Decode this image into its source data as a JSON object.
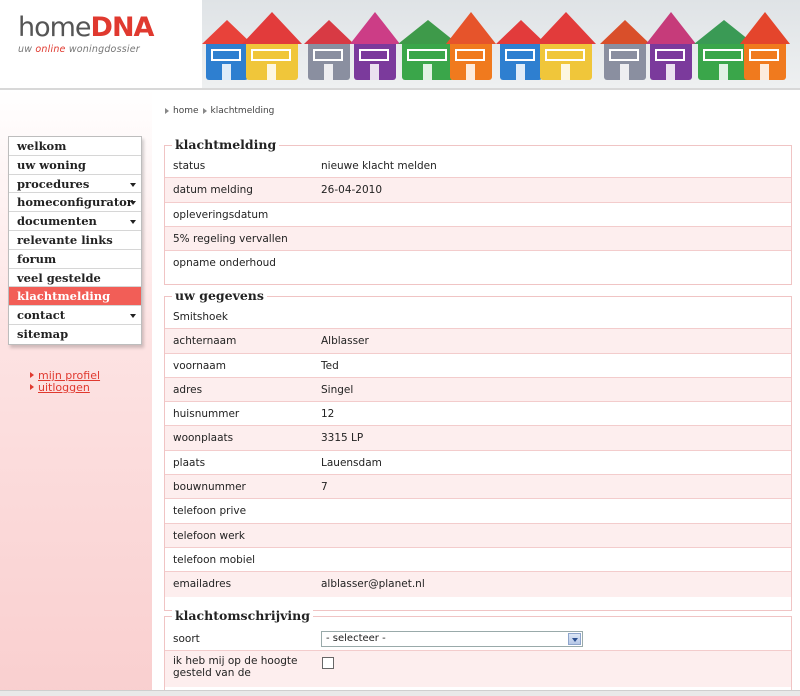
{
  "logo": {
    "brand_home": "home",
    "brand_dna": "DNA",
    "tag_pre": "uw ",
    "tag_online": "online",
    "tag_post": " woningdossier"
  },
  "colors": {
    "accent": "#e0392f",
    "active_menu": "#f25e57",
    "row_pink": "#fdeeee",
    "border_pink": "#f0c4c4"
  },
  "breadcrumb": {
    "items": [
      "home",
      "klachtmelding"
    ]
  },
  "menu": {
    "items": [
      {
        "label": "welkom",
        "has_dropdown": false,
        "active": false
      },
      {
        "label": "uw woning",
        "has_dropdown": false,
        "active": false
      },
      {
        "label": "procedures",
        "has_dropdown": true,
        "active": false
      },
      {
        "label": "homeconfigurator",
        "has_dropdown": true,
        "active": false
      },
      {
        "label": "documenten",
        "has_dropdown": true,
        "active": false
      },
      {
        "label": "relevante links",
        "has_dropdown": false,
        "active": false
      },
      {
        "label": "forum",
        "has_dropdown": false,
        "active": false
      },
      {
        "label": "veel gestelde vragen",
        "has_dropdown": false,
        "active": false
      },
      {
        "label": "klachtmelding",
        "has_dropdown": false,
        "active": true
      },
      {
        "label": "contact",
        "has_dropdown": true,
        "active": false
      },
      {
        "label": "sitemap",
        "has_dropdown": false,
        "active": false
      }
    ]
  },
  "profile_links": {
    "profile": "mijn profiel",
    "logout": "uitloggen"
  },
  "klachtmelding": {
    "title": "klachtmelding",
    "rows": [
      {
        "label": "status",
        "value": "nieuwe klacht melden"
      },
      {
        "label": "datum melding",
        "value": "26-04-2010"
      },
      {
        "label": "opleveringsdatum",
        "value": ""
      },
      {
        "label": "5% regeling vervallen",
        "value": ""
      },
      {
        "label": "opname onderhoud",
        "value": ""
      }
    ]
  },
  "gegevens": {
    "title": "uw gegevens",
    "rows": [
      {
        "label": "Smitshoek",
        "value": ""
      },
      {
        "label": "achternaam",
        "value": "Alblasser"
      },
      {
        "label": "voornaam",
        "value": "Ted"
      },
      {
        "label": "adres",
        "value": "Singel"
      },
      {
        "label": "huisnummer",
        "value": "12"
      },
      {
        "label": "woonplaats",
        "value": "3315 LP"
      },
      {
        "label": "plaats",
        "value": "Lauensdam"
      },
      {
        "label": "bouwnummer",
        "value": "7"
      },
      {
        "label": "telefoon prive",
        "value": ""
      },
      {
        "label": "telefoon werk",
        "value": ""
      },
      {
        "label": "telefoon mobiel",
        "value": ""
      },
      {
        "label": "emailadres",
        "value": "alblasser@planet.nl"
      }
    ]
  },
  "omschrijving": {
    "title": "klachtomschrijving",
    "soort_label": "soort",
    "soort_selected": "- selecteer -",
    "check_label": "ik heb mij op de hoogte gesteld van de",
    "checked": false
  }
}
